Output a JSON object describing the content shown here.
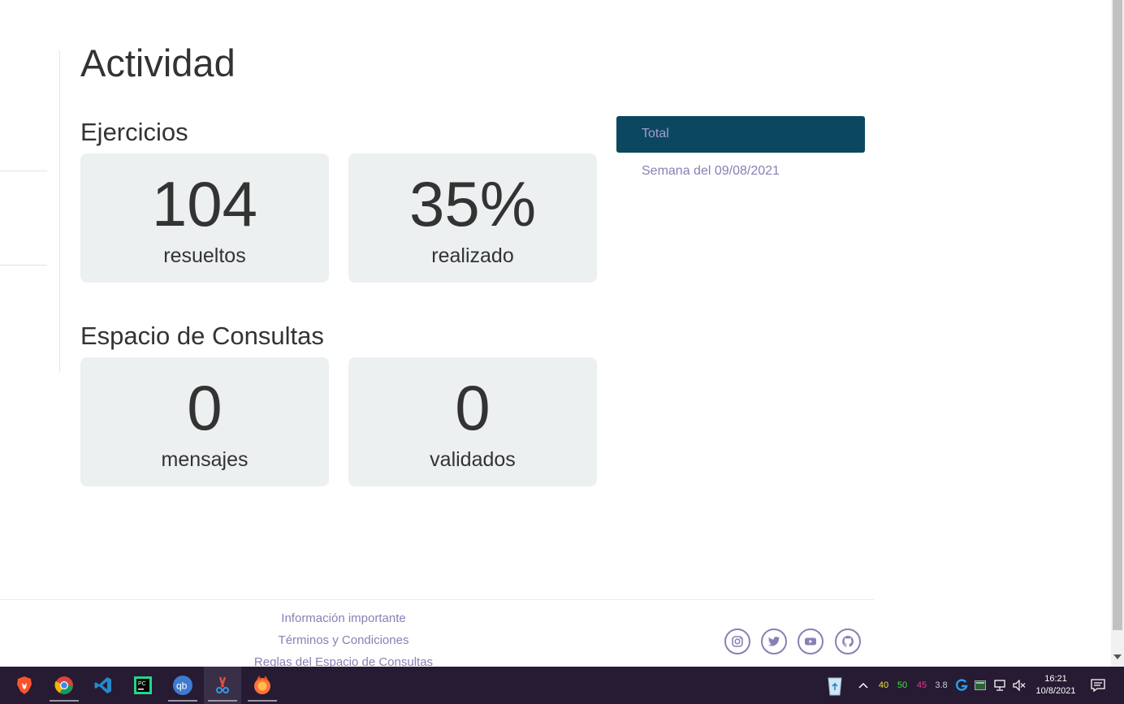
{
  "page": {
    "title": "Actividad"
  },
  "sections": {
    "ejercicios": {
      "title": "Ejercicios",
      "cards": [
        {
          "value": "104",
          "label": "resueltos"
        },
        {
          "value": "35%",
          "label": "realizado"
        }
      ]
    },
    "consultas": {
      "title": "Espacio de Consultas",
      "cards": [
        {
          "value": "0",
          "label": "mensajes"
        },
        {
          "value": "0",
          "label": "validados"
        }
      ]
    }
  },
  "period_tabs": {
    "items": [
      {
        "label": "Total",
        "active": true
      },
      {
        "label": "Semana del 09/08/2021",
        "active": false
      }
    ]
  },
  "footer": {
    "links": [
      "Información importante",
      "Términos y Condiciones",
      "Reglas del Espacio de Consultas"
    ],
    "social_icons": [
      "instagram-icon",
      "twitter-icon",
      "youtube-icon",
      "github-icon"
    ]
  },
  "taskbar": {
    "apps": [
      "brave-icon",
      "chrome-icon",
      "vscode-icon",
      "pycharm-icon",
      "qbittorrent-icon",
      "snipping-tool-icon",
      "firefox-icon"
    ],
    "tray": {
      "stats": [
        {
          "value": "40",
          "color": "#e8e337"
        },
        {
          "value": "50",
          "color": "#37e837"
        },
        {
          "value": "45",
          "color": "#e83795"
        },
        {
          "value": "3.8",
          "color": "#cccccc"
        }
      ],
      "time": "16:21",
      "date": "10/8/2021"
    }
  },
  "colors": {
    "accent": "#0b475e",
    "link": "#8a7fb5",
    "card_bg": "#ecf0f1",
    "taskbar": "#261b33"
  }
}
